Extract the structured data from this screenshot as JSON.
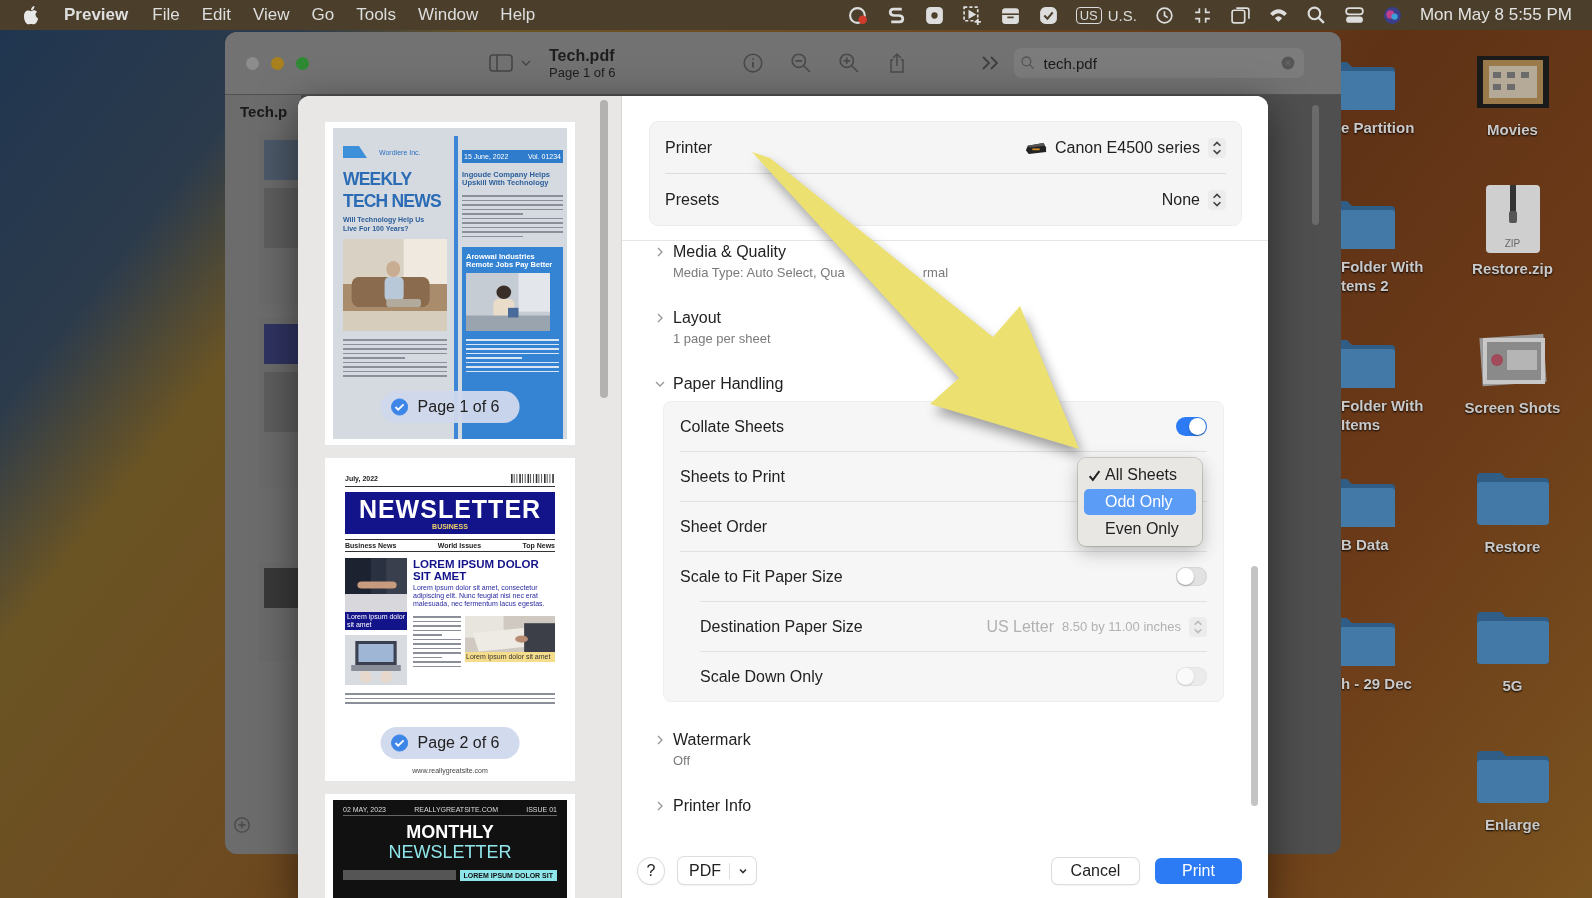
{
  "menu_bar": {
    "app_name": "Preview",
    "menus": [
      "File",
      "Edit",
      "View",
      "Go",
      "Tools",
      "Window",
      "Help"
    ],
    "input_source": {
      "badge": "US",
      "label": "U.S."
    },
    "clock": "Mon May 8  5:55 PM"
  },
  "background_window": {
    "title": "Tech.pdf",
    "subtitle": "Page 1 of 6",
    "search": {
      "placeholder": "tech.pdf"
    },
    "sidebar_title": "Tech.p"
  },
  "desktop_icons": {
    "left_column": [
      {
        "label": "e Partition",
        "kind": "folder"
      },
      {
        "label": "Folder With\ntems 2",
        "kind": "folder"
      },
      {
        "label": "Folder With\nItems",
        "kind": "folder"
      },
      {
        "label": "B Data",
        "kind": "folder"
      },
      {
        "label": "h - 29 Dec",
        "kind": "folder"
      }
    ],
    "right_column": [
      {
        "label": "Movies",
        "kind": "movie"
      },
      {
        "label": "Restore.zip",
        "kind": "zip",
        "badge": "ZIP"
      },
      {
        "label": "Screen Shots",
        "kind": "screenshots"
      },
      {
        "label": "Restore",
        "kind": "folder"
      },
      {
        "label": "5G",
        "kind": "folder"
      },
      {
        "label": "Enlarge",
        "kind": "folder"
      }
    ]
  },
  "print_dialog": {
    "thumbnails": [
      {
        "kind": "weekly",
        "selected": true,
        "badge": "Page 1 of 6",
        "company": "Wordiere Inc.",
        "date": "15 June, 2022",
        "issue": "Vol. 01234",
        "headline": [
          "WEEKLY",
          "TECH NEWS"
        ],
        "subheadline": "Will Technology Help Us Live For 100 Years?",
        "side_headline": "Ingoude Company Helps Upskill With Technology",
        "box_headline": "Arowwai Industries Remote Jobs Pay Better"
      },
      {
        "kind": "newsletter",
        "selected": true,
        "badge": "Page 2 of 6",
        "date": "July, 2022",
        "masthead": "NEWSLETTER",
        "section": "BUSINESS",
        "nav": [
          "Business News",
          "World Issues",
          "Top News"
        ],
        "headline": "LOREM IPSUM DOLOR SIT AMET",
        "lede": "Lorem ipsum dolor sit amet, consectetur adipiscing elit. Nunc feugiat nisi nec erat malesuada, nec fermentum lacus egestas.",
        "side_caption": "Lorem ipsum dolor sit amet",
        "photo_caption": "Lorem ipsum dolor sit amet",
        "footer": "www.reallygreatsite.com"
      },
      {
        "kind": "monthly",
        "date": "02 MAY, 2023",
        "site": "REALLYGREATSITE.COM",
        "issue": "ISSUE 01",
        "masthead": [
          "MONTHLY",
          "NEWSLETTER"
        ],
        "banner": "LOREM IPSUM DOLOR SIT"
      }
    ],
    "printer": {
      "label": "Printer",
      "value": "Canon E4500 series"
    },
    "presets": {
      "label": "Presets",
      "value": "None"
    },
    "sections": [
      {
        "title": "Media & Quality",
        "expanded": false,
        "summary": [
          "Media Type: Auto Select, Qua",
          "rmal"
        ]
      },
      {
        "title": "Layout",
        "expanded": false,
        "summary": [
          "1 page per sheet"
        ]
      },
      {
        "title": "Paper Handling",
        "expanded": true,
        "rows": [
          {
            "kind": "toggle",
            "label": "Collate Sheets",
            "on": true,
            "disabled": false
          },
          {
            "kind": "popup",
            "label": "Sheets to Print"
          },
          {
            "kind": "popup",
            "label": "Sheet Order"
          },
          {
            "kind": "toggle",
            "label": "Scale to Fit Paper Size",
            "on": false,
            "disabled": false,
            "children": [
              {
                "kind": "popup",
                "label": "Destination Paper Size",
                "value": "US Letter",
                "detail": "8.50 by 11.00 inches",
                "disabled": true
              },
              {
                "kind": "toggle",
                "label": "Scale Down Only",
                "on": false,
                "disabled": true
              }
            ]
          }
        ]
      },
      {
        "title": "Watermark",
        "expanded": false,
        "summary": [
          "Off"
        ]
      },
      {
        "title": "Printer Info",
        "expanded": false
      }
    ],
    "sheets_menu": [
      {
        "label": "All Sheets",
        "checked": true,
        "selected": false
      },
      {
        "label": "Odd Only",
        "checked": false,
        "selected": true
      },
      {
        "label": "Even Only",
        "checked": false,
        "selected": false
      }
    ],
    "footer": {
      "help": "?",
      "pdf": "PDF",
      "cancel": "Cancel",
      "print": "Print"
    }
  }
}
